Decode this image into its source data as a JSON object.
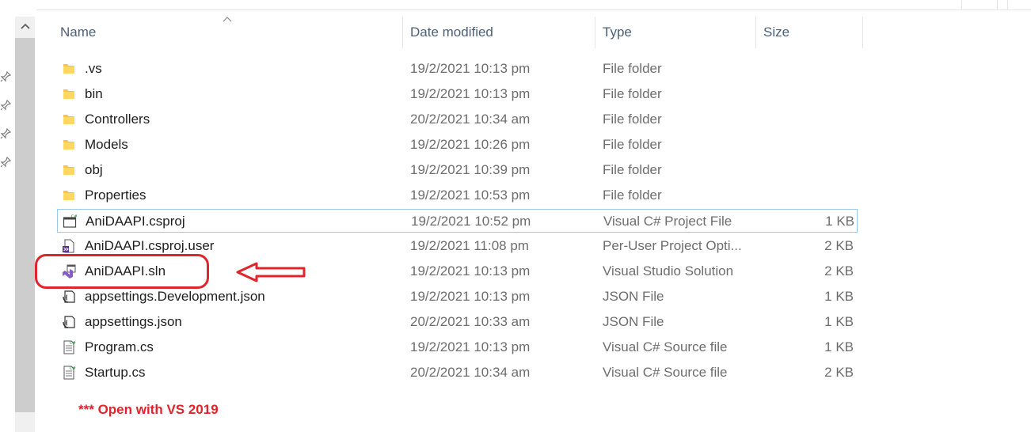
{
  "columns": {
    "name": "Name",
    "date_modified": "Date modified",
    "type": "Type",
    "size": "Size"
  },
  "rows": [
    {
      "name": ".vs",
      "date": "19/2/2021 10:13 pm",
      "type": "File folder",
      "size": "",
      "icon": "folder-icon"
    },
    {
      "name": "bin",
      "date": "19/2/2021 10:13 pm",
      "type": "File folder",
      "size": "",
      "icon": "folder-icon"
    },
    {
      "name": "Controllers",
      "date": "20/2/2021 10:34 am",
      "type": "File folder",
      "size": "",
      "icon": "folder-icon"
    },
    {
      "name": "Models",
      "date": "19/2/2021 10:26 pm",
      "type": "File folder",
      "size": "",
      "icon": "folder-icon"
    },
    {
      "name": "obj",
      "date": "19/2/2021 10:39 pm",
      "type": "File folder",
      "size": "",
      "icon": "folder-icon"
    },
    {
      "name": "Properties",
      "date": "19/2/2021 10:53 pm",
      "type": "File folder",
      "size": "",
      "icon": "folder-icon"
    },
    {
      "name": "AniDAAPI.csproj",
      "date": "19/2/2021 10:52 pm",
      "type": "Visual C# Project File",
      "size": "1 KB",
      "icon": "csproj-icon"
    },
    {
      "name": "AniDAAPI.csproj.user",
      "date": "19/2/2021 11:08 pm",
      "type": "Per-User Project Opti...",
      "size": "2 KB",
      "icon": "user-file-icon"
    },
    {
      "name": "AniDAAPI.sln",
      "date": "19/2/2021 10:13 pm",
      "type": "Visual Studio Solution",
      "size": "2 KB",
      "icon": "vs-solution-icon"
    },
    {
      "name": "appsettings.Development.json",
      "date": "19/2/2021 10:13 pm",
      "type": "JSON File",
      "size": "1 KB",
      "icon": "json-icon"
    },
    {
      "name": "appsettings.json",
      "date": "20/2/2021 10:33 am",
      "type": "JSON File",
      "size": "1 KB",
      "icon": "json-icon"
    },
    {
      "name": "Program.cs",
      "date": "19/2/2021 10:13 pm",
      "type": "Visual C# Source file",
      "size": "1 KB",
      "icon": "cs-file-icon"
    },
    {
      "name": "Startup.cs",
      "date": "20/2/2021 10:34 am",
      "type": "Visual C# Source file",
      "size": "2 KB",
      "icon": "cs-file-icon"
    }
  ],
  "annotation": {
    "note": "*** Open with VS 2019",
    "color": "#e0242c"
  },
  "colors": {
    "header_text": "#4c607a",
    "folder": "#f4c542",
    "selection_border": "#99c9ef",
    "scroll_thumb": "#cdcdcd"
  }
}
